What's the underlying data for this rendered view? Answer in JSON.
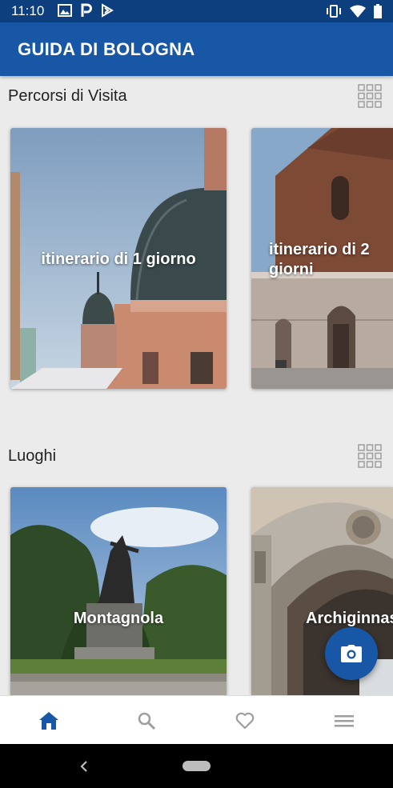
{
  "status_bar": {
    "time": "11:10",
    "left_icons": [
      "gallery-icon",
      "parking-icon",
      "flag-icon"
    ],
    "right_icons": [
      "vibrate-icon",
      "wifi-icon",
      "battery-icon"
    ]
  },
  "app_bar": {
    "title": "GUIDA DI BOLOGNA"
  },
  "sections": [
    {
      "title": "Percorsi di Visita",
      "icon": "grid-view-icon",
      "cards": [
        {
          "label": "itinerario di 1 giorno",
          "image": "church-dome-photo"
        },
        {
          "label": "itinerario di 2 giorni",
          "image": "basilica-facade-photo"
        }
      ]
    },
    {
      "title": "Luoghi",
      "icon": "grid-view-icon",
      "cards": [
        {
          "label": "Montagnola",
          "image": "monument-park-photo"
        },
        {
          "label": "Archiginnasio",
          "image": "arched-portico-photo"
        }
      ]
    }
  ],
  "fab": {
    "icon": "camera-icon"
  },
  "bottom_nav": [
    {
      "name": "home",
      "icon": "home-icon",
      "active": true
    },
    {
      "name": "search",
      "icon": "search-icon",
      "active": false
    },
    {
      "name": "favorites",
      "icon": "heart-icon",
      "active": false
    },
    {
      "name": "menu",
      "icon": "menu-icon",
      "active": false
    }
  ],
  "colors": {
    "primary": "#1856a6",
    "status_bar": "#0d3e7e",
    "active_nav": "#1856a6",
    "inactive_nav": "#9e9e9e"
  }
}
